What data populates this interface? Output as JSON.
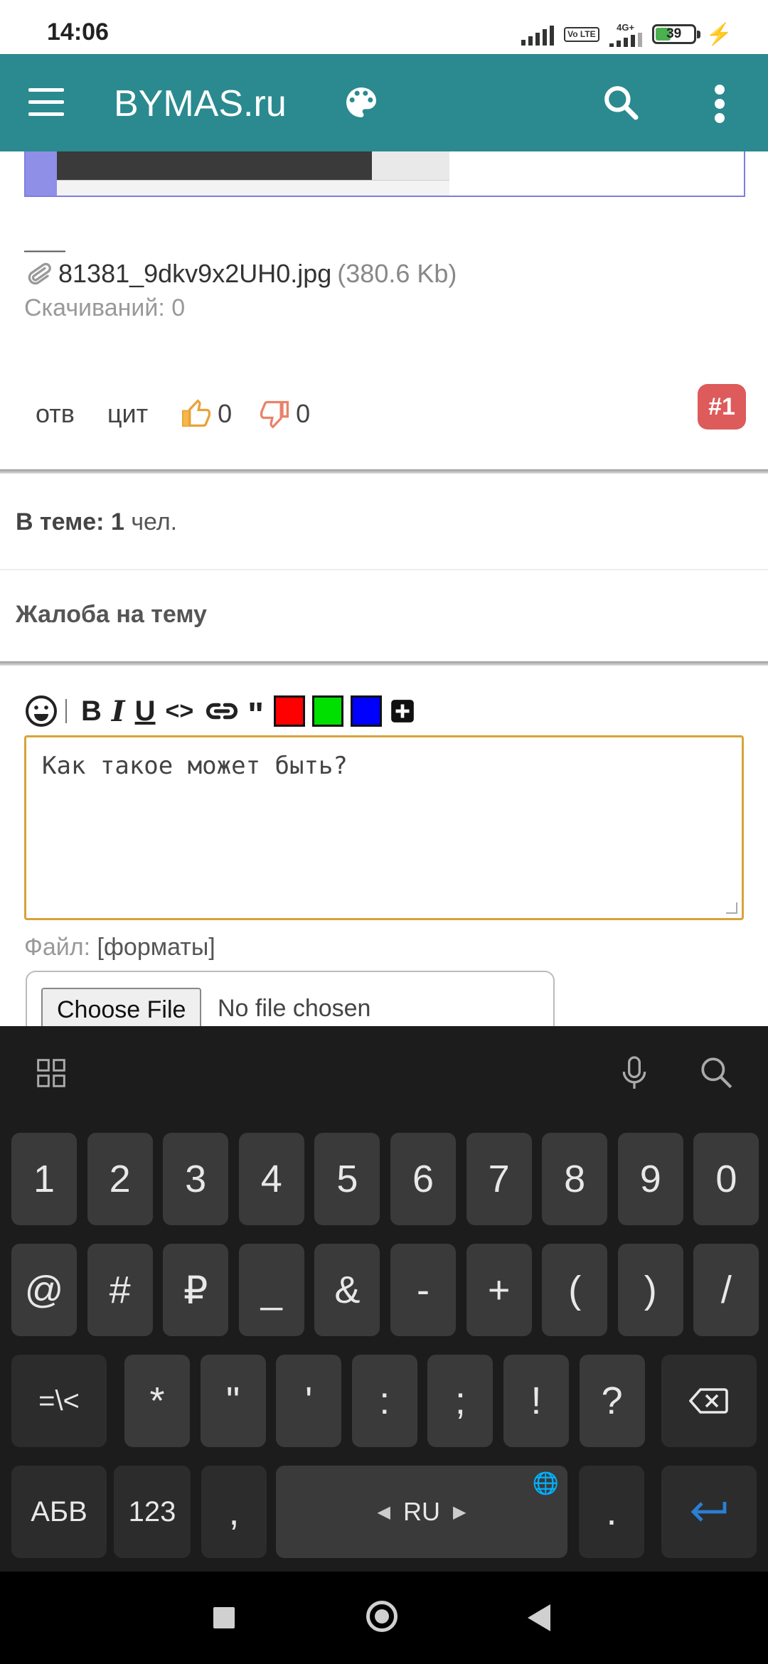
{
  "status_bar": {
    "time": "14:06",
    "volte": "Vo LTE",
    "network": "4G+",
    "battery": "39"
  },
  "app_bar": {
    "title": "BYMAS.ru"
  },
  "post": {
    "separator": "——",
    "attachment": {
      "filename": "81381_9dkv9x2UH0.jpg",
      "size": "(380.6 Kb)"
    },
    "downloads": "Скачиваний: 0",
    "actions": {
      "reply": "отв",
      "quote": "цит",
      "likes": "0",
      "dislikes": "0"
    },
    "post_number": "#1"
  },
  "topic": {
    "in_topic_label": "В теме:",
    "in_topic_count": "1",
    "in_topic_unit": "чел.",
    "complaint": "Жалоба на тему"
  },
  "editor": {
    "toolbar": {
      "bold": "B",
      "italic": "I",
      "underline": "U",
      "code": "<>",
      "quote": "\"",
      "colors": [
        "#ff0000",
        "#00e000",
        "#0000ff"
      ]
    },
    "text": "Как такое может быть?",
    "file_label": "Файл:",
    "file_formats": "[форматы]",
    "choose_file": "Choose File",
    "no_file": "No file chosen"
  },
  "keyboard": {
    "row1": [
      "1",
      "2",
      "3",
      "4",
      "5",
      "6",
      "7",
      "8",
      "9",
      "0"
    ],
    "row2": [
      "@",
      "#",
      "₽",
      "_",
      "&",
      "-",
      "+",
      "(",
      ")",
      "/"
    ],
    "row3": [
      "*",
      "\"",
      "'",
      ":",
      ";",
      "!",
      "?"
    ],
    "symbols_key": "=\\<",
    "abc_key": "АБВ",
    "num_key": "123",
    "comma": ",",
    "space": "RU",
    "period": ".",
    "accent": "#2a7fd4"
  }
}
